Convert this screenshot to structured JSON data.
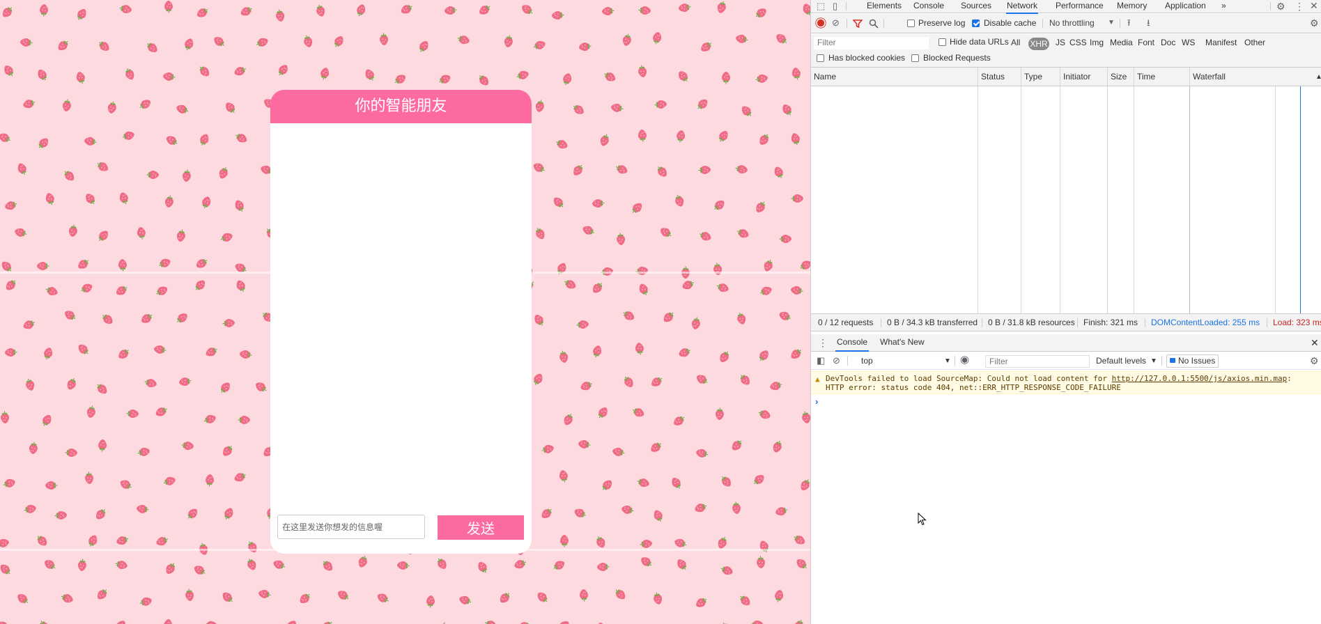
{
  "chat": {
    "title": "你的智能朋友",
    "input_placeholder": "在这里发送你想发的信息喔",
    "input_value": "",
    "send_label": "发送",
    "accent_color": "#fd6a9f",
    "background_color": "#fcdadf"
  },
  "devtools": {
    "tabs": [
      "Elements",
      "Console",
      "Sources",
      "Network",
      "Performance",
      "Memory",
      "Application"
    ],
    "active_tab": "Network",
    "more_tabs_icon": "»",
    "toolbar": {
      "preserve_log": "Preserve log",
      "preserve_log_checked": false,
      "disable_cache": "Disable cache",
      "disable_cache_checked": true,
      "throttling": "No throttling"
    },
    "filter": {
      "placeholder": "Filter",
      "hide_data_urls": "Hide data URLs",
      "types": [
        "All",
        "XHR",
        "JS",
        "CSS",
        "Img",
        "Media",
        "Font",
        "Doc",
        "WS",
        "Manifest",
        "Other"
      ],
      "active_type": "XHR",
      "has_blocked_cookies": "Has blocked cookies",
      "blocked_requests": "Blocked Requests"
    },
    "columns": [
      "Name",
      "Status",
      "Type",
      "Initiator",
      "Size",
      "Time",
      "Waterfall"
    ],
    "summary": {
      "requests": "0 / 12 requests",
      "transferred": "0 B / 34.3 kB transferred",
      "resources": "0 B / 31.8 kB resources",
      "finish": "Finish: 321 ms",
      "dom_content_loaded": "DOMContentLoaded: 255 ms",
      "load": "Load: 323 ms",
      "dcl_color": "#1a73e8",
      "load_color": "#c5221f"
    },
    "drawer": {
      "tabs": [
        "Console",
        "What's New"
      ],
      "active_tab": "Console",
      "context": "top",
      "filter_placeholder": "Filter",
      "levels": "Default levels",
      "issues": "No Issues"
    },
    "console": {
      "warning_prefix": "DevTools failed to load SourceMap: Could not load content for ",
      "warning_link": "http://127.0.0.1:5500/js/axios.min.map",
      "warning_suffix": ":",
      "warning_line2": "HTTP error: status code 404, net::ERR_HTTP_RESPONSE_CODE_FAILURE",
      "prompt": "›"
    }
  }
}
